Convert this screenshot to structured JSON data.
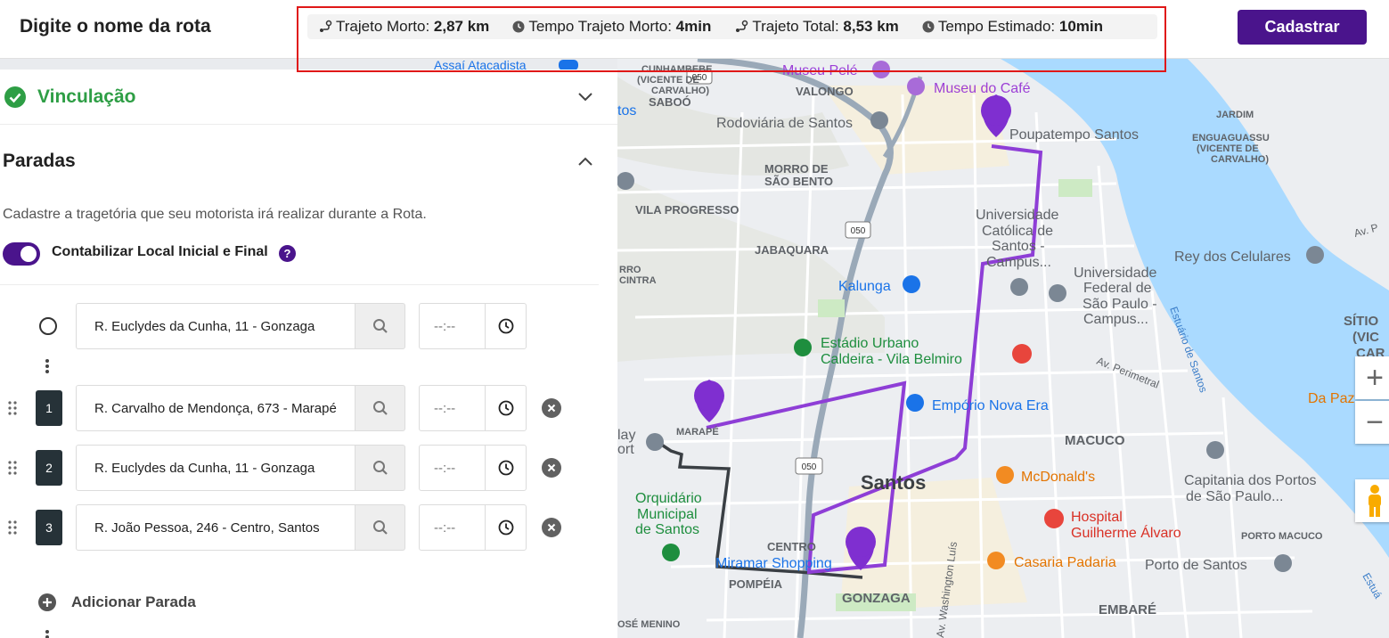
{
  "header": {
    "route_name": "Digite o nome da rota",
    "stats": [
      {
        "label": "Trajeto Morto:",
        "value": "2,87 km",
        "icon": "route-icon"
      },
      {
        "label": "Tempo Trajeto Morto:",
        "value": "4min",
        "icon": "clock-icon"
      },
      {
        "label": "Trajeto Total:",
        "value": "8,53 km",
        "icon": "route-icon"
      },
      {
        "label": "Tempo Estimado:",
        "value": "10min",
        "icon": "clock-icon"
      }
    ],
    "submit_label": "Cadastrar"
  },
  "sections": {
    "vinculacao": "Vinculação",
    "paradas": "Paradas",
    "description": "Cadastre a tragetória que seu motorista irá realizar durante a Rota.",
    "toggle_label": "Contabilizar Local Inicial e Final",
    "help_symbol": "?"
  },
  "stops": {
    "origin": {
      "address": "R. Euclydes da Cunha, 11 - Gonzaga",
      "time_placeholder": "--:--"
    },
    "list": [
      {
        "number": "1",
        "address": "R. Carvalho de Mendonça, 673 - Marapé",
        "time_placeholder": "--:--"
      },
      {
        "number": "2",
        "address": "R. Euclydes da Cunha, 11 - Gonzaga",
        "time_placeholder": "--:--"
      },
      {
        "number": "3",
        "address": "R. João Pessoa, 246 - Centro, Santos",
        "time_placeholder": "--:--"
      }
    ],
    "add_label": "Adicionar Parada"
  },
  "map": {
    "city": "Santos",
    "districts": [
      "SABOÓ",
      "VALONGO",
      "MORRO DE",
      "SÃO BENTO",
      "VILA PROGRESSO",
      "JABAQUARA",
      "MACUCO",
      "CENTRO",
      "POMPÉIA",
      "GONZAGA",
      "EMBARÉ",
      "MARAPÉ",
      "CUNHAMBEBE",
      "(VICENTE DE",
      "CARVALHO)",
      "JARDIM",
      "ENGUAGUASSU",
      "(VICENTE DE",
      "CARVALHO)",
      "PORTO MACUCO",
      "SÍTIO",
      "(VIC",
      "CAR",
      "RRO",
      "CINTRA",
      "OSÉ MENINO"
    ],
    "pois": [
      "Assaí Atacadista",
      "Museu Pelé",
      "Museu do Café",
      "Rodoviária de Santos",
      "Poupatempo Santos",
      "Universidade",
      "Católica de",
      "Santos -",
      "Campus...",
      "Universidade",
      "Federal de",
      "São Paulo -",
      "Campus...",
      "Rey dos Celulares",
      "Kalunga",
      "Estádio Urbano",
      "Caldeira - Vila Belmiro",
      "Empório Nova Era",
      "McDonald's",
      "Orquidário",
      "Municipal",
      "de Santos",
      "Miramar Shopping",
      "Hospital",
      "Guilherme Álvaro",
      "Casaria Padaria",
      "Porto de Santos",
      "Capitania dos Portos",
      "de São Paulo...",
      "Da Paz",
      "Estuário de Santos",
      "Av. Perimetral",
      "Av. Washington Luís",
      "tos",
      "lay",
      "ort",
      "Av. P",
      "Estuá"
    ],
    "road_shields": [
      "050",
      "050",
      "050"
    ],
    "zoom_in": "+",
    "zoom_out": "−"
  },
  "colors": {
    "accent": "#4a148c",
    "route": "#8e3ed6",
    "deadhead": "#3a3f44",
    "success": "#2e9e45",
    "highlight": "#e01818"
  }
}
